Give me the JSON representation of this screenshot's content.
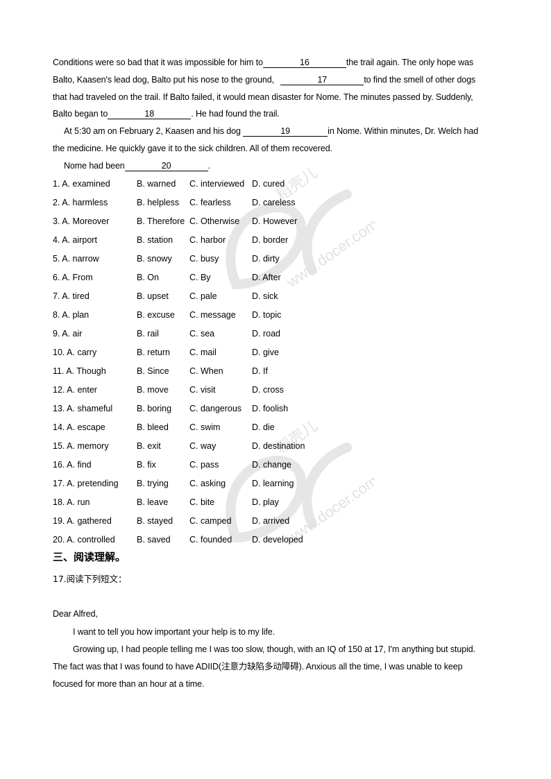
{
  "passage": {
    "line1_pre": "Conditions were so bad that it was impossible for him to",
    "blank16": "16",
    "line1_post": "the trail again. The only hope was",
    "line2_pre": "Balto, Kaasen's lead dog, Balto put his nose to the ground, ",
    "blank17": "17",
    "line2_post": "to find the smell of other dogs",
    "line3": "that had traveled on the trail. If Balto failed, it would mean disaster for Nome. The minutes passed by. Suddenly,",
    "line4_pre": "Balto began to",
    "blank18": "18",
    "line4_post": ". He had found the trail.",
    "line5_pre": "At 5:30 am on February 2, Kaasen and his dog ",
    "blank19": "19",
    "line5_post": "in Nome. Within minutes, Dr. Welch had",
    "line6": "the medicine. He quickly gave it to the sick children. All of them recovered.",
    "line7_pre": "Nome had been",
    "blank20": "20",
    "line7_post": "."
  },
  "options": [
    {
      "a": "1. A. examined",
      "b": "B. warned",
      "c": "C. interviewed",
      "d": "D. cured"
    },
    {
      "a": "2. A. harmless",
      "b": "B. helpless",
      "c": "C. fearless",
      "d": "D. careless"
    },
    {
      "a": "3. A. Moreover",
      "b": "B. Therefore",
      "c": "C. Otherwise",
      "d": "D. However"
    },
    {
      "a": "4. A. airport",
      "b": "B. station",
      "c": "C. harbor",
      "d": "D. border"
    },
    {
      "a": "5. A. narrow",
      "b": "B. snowy",
      "c": "C. busy",
      "d": "D. dirty"
    },
    {
      "a": "6. A. From",
      "b": "B. On",
      "c": "C. By",
      "d": "D. After"
    },
    {
      "a": "7. A. tired",
      "b": "B. upset",
      "c": "C. pale",
      "d": "D. sick"
    },
    {
      "a": "8. A. plan",
      "b": "B. excuse",
      "c": "C. message",
      "d": "D. topic"
    },
    {
      "a": "9. A. air",
      "b": "B. rail",
      "c": "C. sea",
      "d": "D. road"
    },
    {
      "a": "10. A. carry",
      "b": "B. return",
      "c": "C. mail",
      "d": "D. give"
    },
    {
      "a": "11. A. Though",
      "b": "B. Since",
      "c": "C. When",
      "d": "D. If"
    },
    {
      "a": "12. A. enter",
      "b": "B. move",
      "c": "C. visit",
      "d": "D. cross"
    },
    {
      "a": "13. A. shameful",
      "b": "B. boring",
      "c": "C. dangerous",
      "d": "D. foolish"
    },
    {
      "a": "14. A. escape",
      "b": "B. bleed",
      "c": "C. swim",
      "d": "D. die"
    },
    {
      "a": "15. A. memory",
      "b": "B. exit",
      "c": "C. way",
      "d": "D. destination"
    },
    {
      "a": "16. A. find",
      "b": "B. fix",
      "c": "C. pass",
      "d": "D. change"
    },
    {
      "a": "17. A. pretending",
      "b": "B. trying",
      "c": "C. asking",
      "d": "D. learning"
    },
    {
      "a": "18. A. run",
      "b": "B. leave",
      "c": "C. bite",
      "d": "D. play"
    },
    {
      "a": "19. A. gathered",
      "b": "B. stayed",
      "c": "C. camped",
      "d": "D. arrived"
    },
    {
      "a": "20. A. controlled",
      "b": "B. saved",
      "c": "C. founded",
      "d": "D. developed"
    }
  ],
  "section3": {
    "title": "三、阅读理解。",
    "question": "17.阅读下列短文：",
    "salutation": "Dear Alfred,",
    "para1": "I want to tell you how important your help is to my life.",
    "para2_line1": "Growing up, I had people telling me I was too slow, though, with an IQ of 150 at 17, I'm anything but stupid.",
    "para2_line2": "The fact was that I was found to have ADIID(注意力缺陷多动障碍). Anxious all the time, I was unable to keep",
    "para2_line3": "focused for more than an hour at a time."
  },
  "watermark": {
    "brand_cn": "稻壳儿",
    "site": "www.docer.com",
    "color": "#d9d9d9"
  }
}
